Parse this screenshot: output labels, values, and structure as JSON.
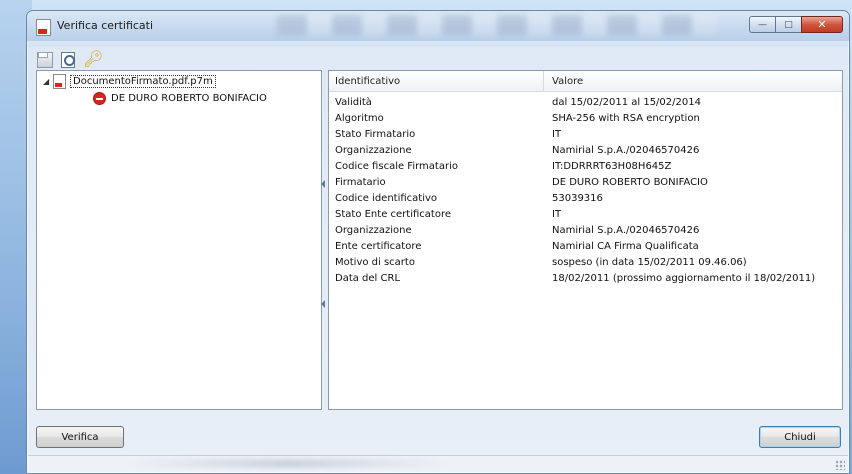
{
  "window": {
    "title": "Verifica certificati"
  },
  "toolbar": {
    "icons": [
      "save-icon",
      "view-certificate-icon",
      "key-icon"
    ]
  },
  "tree": {
    "root": {
      "label": "DocumentoFirmato.pdf.p7m",
      "icon": "pdf-file-icon",
      "expanded": true
    },
    "children": [
      {
        "label": "DE DURO ROBERTO BONIFACIO",
        "icon": "invalid-signature-icon"
      }
    ]
  },
  "details": {
    "headers": {
      "key": "Identificativo",
      "value": "Valore"
    },
    "rows": [
      {
        "key": "Validità",
        "value": "dal 15/02/2011 al 15/02/2014"
      },
      {
        "key": "Algoritmo",
        "value": "SHA-256 with RSA encryption"
      },
      {
        "key": "Stato Firmatario",
        "value": "IT"
      },
      {
        "key": "Organizzazione",
        "value": "Namirial S.p.A./02046570426"
      },
      {
        "key": "Codice fiscale Firmatario",
        "value": "IT:DDRRRT63H08H645Z"
      },
      {
        "key": "Firmatario",
        "value": "DE DURO ROBERTO BONIFACIO"
      },
      {
        "key": "Codice identificativo",
        "value": "53039316"
      },
      {
        "key": "Stato Ente certificatore",
        "value": "IT"
      },
      {
        "key": "Organizzazione",
        "value": "Namirial S.p.A./02046570426"
      },
      {
        "key": "Ente certificatore",
        "value": "Namirial CA Firma Qualificata"
      },
      {
        "key": "Motivo di scarto",
        "value": "sospeso (in data 15/02/2011 09.46.06)"
      },
      {
        "key": "Data del CRL",
        "value": "18/02/2011 (prossimo aggiornamento il 18/02/2011)"
      }
    ]
  },
  "buttons": {
    "verify": "Verifica",
    "close": "Chiudi"
  },
  "colors": {
    "error_red": "#d9261c",
    "window_border": "#6b87a8",
    "close_button": "#c23a22"
  }
}
